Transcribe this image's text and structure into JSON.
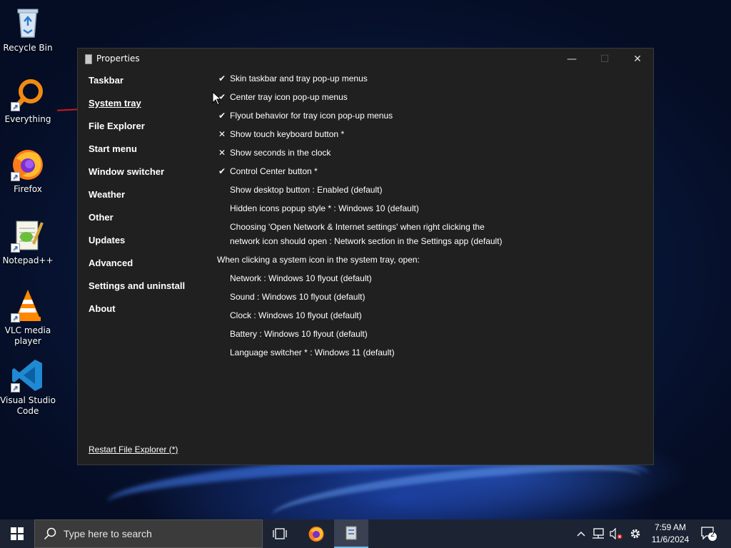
{
  "desktop": {
    "icons": [
      {
        "label": "Recycle Bin",
        "icon": "recycle-bin-icon"
      },
      {
        "label": "Everything",
        "icon": "everything-search-icon"
      },
      {
        "label": "Firefox",
        "icon": "firefox-icon"
      },
      {
        "label": "Notepad++",
        "icon": "notepad-plus-plus-icon"
      },
      {
        "label": "VLC media player",
        "icon": "vlc-icon"
      },
      {
        "label": "Visual Studio Code",
        "icon": "vscode-icon"
      }
    ]
  },
  "window": {
    "title": "Properties",
    "controls": {
      "minimize": "—",
      "maximize": "☐",
      "close": "✕"
    },
    "nav": [
      {
        "label": "Taskbar",
        "active": false
      },
      {
        "label": "System tray",
        "active": true
      },
      {
        "label": "File Explorer",
        "active": false
      },
      {
        "label": "Start menu",
        "active": false
      },
      {
        "label": "Window switcher",
        "active": false
      },
      {
        "label": "Weather",
        "active": false
      },
      {
        "label": "Other",
        "active": false
      },
      {
        "label": "Updates",
        "active": false
      },
      {
        "label": "Advanced",
        "active": false
      },
      {
        "label": "Settings and uninstall",
        "active": false
      },
      {
        "label": "About",
        "active": false
      }
    ],
    "restart_link": "Restart File Explorer (*)",
    "options": [
      {
        "mark": "✔",
        "label": "Skin taskbar and tray pop-up menus"
      },
      {
        "mark": "✔",
        "label": "Center tray icon pop-up menus"
      },
      {
        "mark": "✔",
        "label": "Flyout behavior for tray icon pop-up menus"
      },
      {
        "mark": "✕",
        "label": "Show touch keyboard button *"
      },
      {
        "mark": "✕",
        "label": "Show seconds in the clock"
      },
      {
        "mark": "✔",
        "label": "Control Center button *"
      },
      {
        "mark": "",
        "label": "Show desktop button : Enabled (default)"
      },
      {
        "mark": "",
        "label": "Hidden icons popup style * : Windows 10 (default)"
      },
      {
        "mark": "",
        "label": "Choosing 'Open Network & Internet settings' when right clicking the"
      },
      {
        "mark": "",
        "label": "network icon should open : Network section in the Settings app (default)"
      }
    ],
    "section_heading": "When clicking a system icon in the system tray, open:",
    "sub_options": [
      "Network : Windows 10 flyout (default)",
      "Sound : Windows 10 flyout (default)",
      "Clock : Windows 10 flyout (default)",
      "Battery : Windows 10 flyout (default)",
      "Language switcher * : Windows 11 (default)"
    ]
  },
  "taskbar": {
    "search_placeholder": "Type here to search",
    "apps": [
      "task-view-icon",
      "firefox-icon",
      "properties-app-icon"
    ],
    "tray": {
      "chevron": "^",
      "icons": [
        "network-icon",
        "volume-muted-icon",
        "settings-gear-icon"
      ],
      "time": "7:59 AM",
      "date": "11/6/2024",
      "notification_count": "2"
    }
  }
}
